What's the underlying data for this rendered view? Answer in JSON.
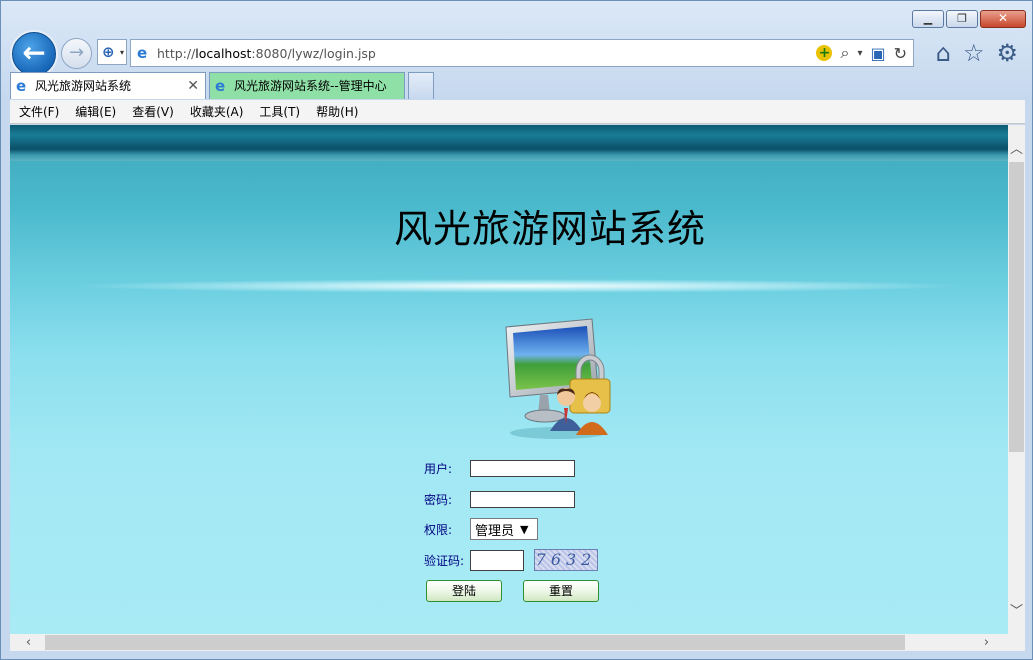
{
  "browser": {
    "url_prefix": "http://",
    "url_host": "localhost",
    "url_rest": ":8080/lywz/login.jsp",
    "tabs": [
      {
        "label": "风光旅游网站系统",
        "active": true
      },
      {
        "label": "风光旅游网站系统--管理中心",
        "active": false
      }
    ],
    "menu": [
      "文件(F)",
      "编辑(E)",
      "查看(V)",
      "收藏夹(A)",
      "工具(T)",
      "帮助(H)"
    ]
  },
  "page": {
    "title": "风光旅游网站系统",
    "form": {
      "user_label": "用户:",
      "user_value": "",
      "password_label": "密码:",
      "password_value": "",
      "role_label": "权限:",
      "role_selected": "管理员",
      "captcha_label": "验证码:",
      "captcha_value": "",
      "captcha_text": "7632",
      "login_button": "登陆",
      "reset_button": "重置"
    }
  }
}
